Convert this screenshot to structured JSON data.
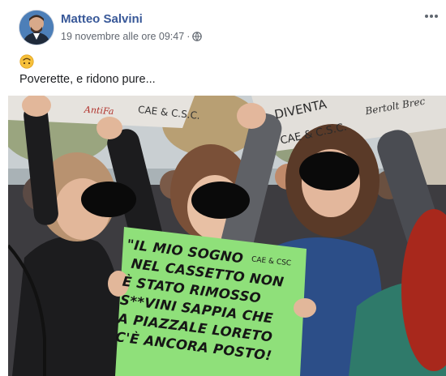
{
  "post": {
    "author": "Matteo Salvini",
    "timestamp": "19 novembre alle ore 09:47",
    "separator": "·",
    "privacy_icon": "globe-icon",
    "more_icon": "more-horizontal-icon",
    "reaction_emoji": "upside-down-face-emoji",
    "caption": "Poverette, e ridono pure..."
  },
  "photo": {
    "banner_left": [
      "AntiFa",
      "CAE & C.S.C."
    ],
    "banner_right": [
      "DIVENTA",
      "CAE & C.S.C.",
      "Bertolt Brec"
    ],
    "sign_tag": "CAE & CSC",
    "sign_lines": [
      "\"IL MIO SOGNO",
      "NEL CASSETTO NON",
      "È STATO RIMOSSO",
      "S**VINI SAPPIA CHE",
      "A PIAZZALE LORETO",
      "C'È ANCORA POSTO!"
    ],
    "colors": {
      "sign_green": "#8fe07a",
      "link_blue": "#385898",
      "meta_gray": "#616770"
    }
  }
}
